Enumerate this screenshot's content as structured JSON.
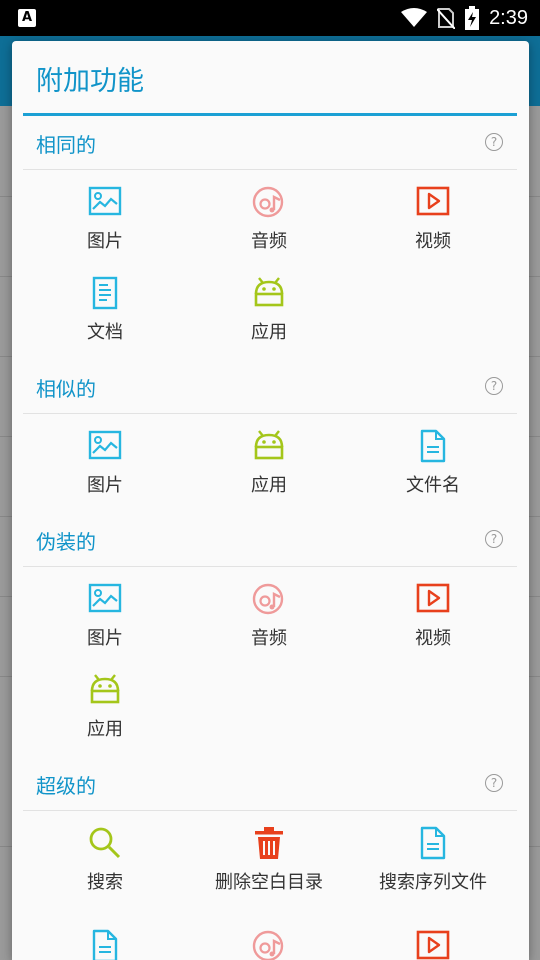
{
  "status_bar": {
    "time": "2:39",
    "left_icon": "A"
  },
  "dialog": {
    "title": "附加功能",
    "sections": [
      {
        "header": "相同的",
        "items": [
          {
            "label": "图片",
            "icon": "image-icon"
          },
          {
            "label": "音频",
            "icon": "audio-icon"
          },
          {
            "label": "视频",
            "icon": "video-icon"
          },
          {
            "label": "文档",
            "icon": "document-icon"
          },
          {
            "label": "应用",
            "icon": "android-icon"
          }
        ]
      },
      {
        "header": "相似的",
        "items": [
          {
            "label": "图片",
            "icon": "image-icon"
          },
          {
            "label": "应用",
            "icon": "android-icon"
          },
          {
            "label": "文件名",
            "icon": "file-icon"
          }
        ]
      },
      {
        "header": "伪装的",
        "items": [
          {
            "label": "图片",
            "icon": "image-icon"
          },
          {
            "label": "音频",
            "icon": "audio-icon"
          },
          {
            "label": "视频",
            "icon": "video-icon"
          },
          {
            "label": "应用",
            "icon": "android-icon"
          }
        ]
      },
      {
        "header": "超级的",
        "items": [
          {
            "label": "搜索",
            "icon": "search-icon"
          },
          {
            "label": "删除空白目录",
            "icon": "trash-icon"
          },
          {
            "label": "搜索序列文件",
            "icon": "file-icon"
          }
        ]
      }
    ],
    "help_glyph": "?"
  },
  "colors": {
    "accent": "#1194c9",
    "image": "#26b6e0",
    "audio": "#ef9a9a",
    "video": "#e8401c",
    "android": "#a4c61a",
    "document": "#26b6e0",
    "search": "#a4c61a",
    "trash": "#e8401c"
  }
}
